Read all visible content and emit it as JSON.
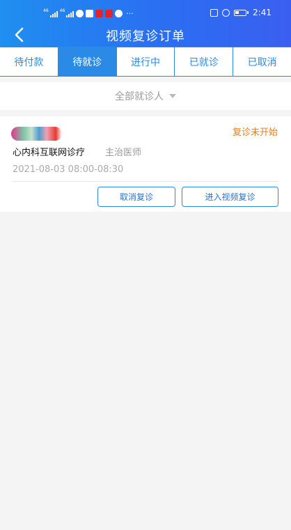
{
  "status_bar": {
    "signal_labels": [
      "46",
      "46"
    ],
    "overflow": "···",
    "time": "2:41",
    "icons": [
      "signal-icon",
      "wifi-icon",
      "app-icon",
      "app-icon",
      "app-icon",
      "app-icon",
      "nfc-icon",
      "alarm-icon",
      "battery-icon"
    ]
  },
  "header": {
    "title": "视频复诊订单",
    "back_icon": "chevron-left-icon"
  },
  "tabs": [
    {
      "label": "待付款",
      "active": false
    },
    {
      "label": "待就诊",
      "active": true
    },
    {
      "label": "进行中",
      "active": false
    },
    {
      "label": "已就诊",
      "active": false
    },
    {
      "label": "已取消",
      "active": false
    }
  ],
  "filter": {
    "label": "全部就诊人",
    "icon": "caret-down-icon"
  },
  "orders": [
    {
      "status": "复诊未开始",
      "department": "心内科互联网诊疗",
      "doctor_title": "主治医师",
      "time": "2021-08-03 08:00-08:30",
      "cancel_label": "取消复诊",
      "enter_label": "进入视频复诊"
    }
  ],
  "colors": {
    "accent": "#2b8ae6",
    "status_orange": "#e67e22",
    "header_gradient_start": "#1f8ff0",
    "header_gradient_end": "#3a5ff0",
    "background": "#f4f4f4"
  }
}
